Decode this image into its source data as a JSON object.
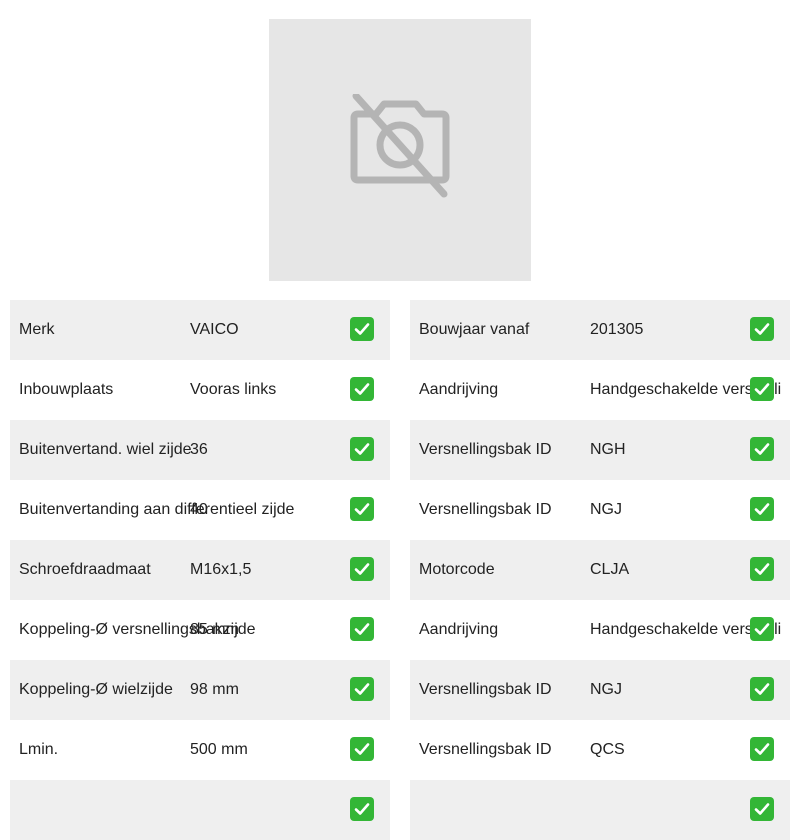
{
  "image_placeholder": {
    "icon": "camera-off-icon",
    "color": "#b4b4b4"
  },
  "left_specs": [
    {
      "label": "Merk",
      "value": "VAICO"
    },
    {
      "label": "Inbouwplaats",
      "value": "Vooras links"
    },
    {
      "label": "Buitenvertand. wiel zijde",
      "value": "36"
    },
    {
      "label": "Buitenvertanding aan differentieel zijde",
      "value": "40"
    },
    {
      "label": "Schroefdraadmaat",
      "value": "M16x1,5"
    },
    {
      "label": "Koppeling-Ø versnellingsbakzijde",
      "value": "85 mm"
    },
    {
      "label": "Koppeling-Ø wielzijde",
      "value": "98 mm"
    },
    {
      "label": "Lmin.",
      "value": "500 mm"
    },
    {
      "label": "",
      "value": ""
    }
  ],
  "right_specs": [
    {
      "label": "Bouwjaar vanaf",
      "value": "201305"
    },
    {
      "label": "Aandrijving",
      "value": "Handgeschakelde versnelli"
    },
    {
      "label": "Versnellingsbak ID",
      "value": "NGH"
    },
    {
      "label": "Versnellingsbak ID",
      "value": "NGJ"
    },
    {
      "label": "Motorcode",
      "value": "CLJA"
    },
    {
      "label": "Aandrijving",
      "value": "Handgeschakelde versnelli"
    },
    {
      "label": "Versnellingsbak ID",
      "value": "NGJ"
    },
    {
      "label": "Versnellingsbak ID",
      "value": "QCS"
    },
    {
      "label": "",
      "value": ""
    }
  ],
  "check_icon": "check-mark-icon",
  "colors": {
    "row_alt": "#efefef",
    "check": "#33b636",
    "placeholder_bg": "#e6e6e6"
  }
}
